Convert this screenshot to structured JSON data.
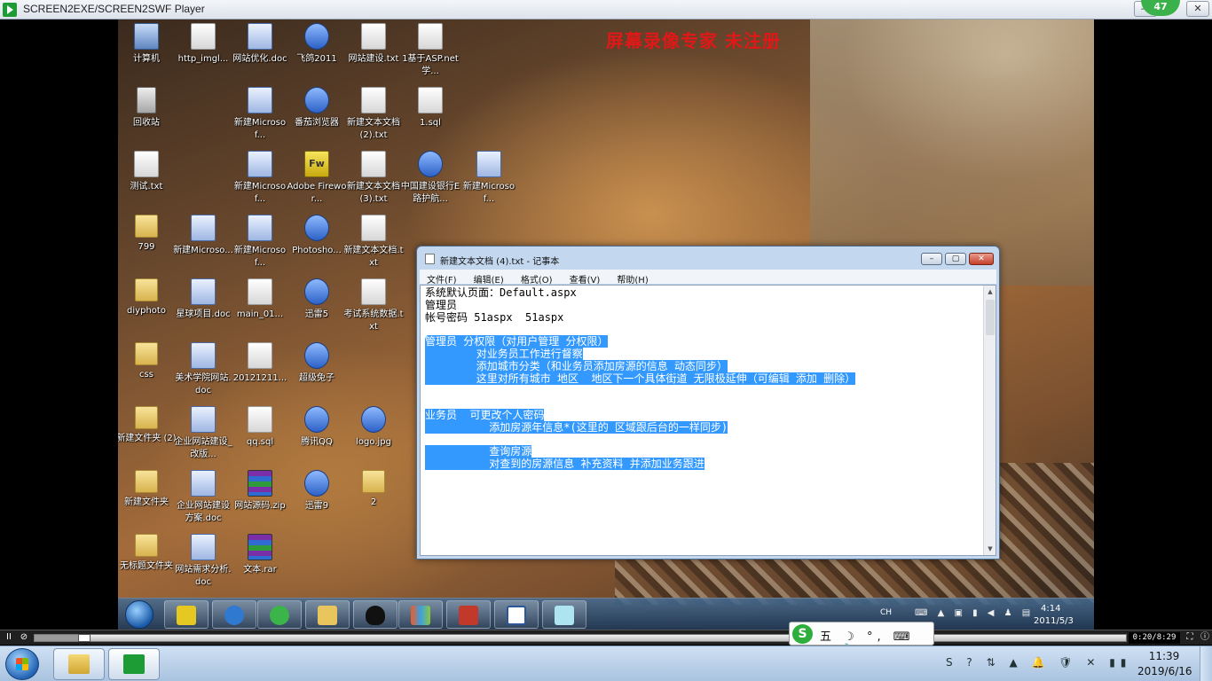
{
  "player": {
    "title": "SCREEN2EXE/SCREEN2SWF Player",
    "badge": "47",
    "controls": {
      "minimize": "—",
      "maximize": "▢",
      "close": "✕"
    }
  },
  "watermark": "屏幕录像专家 未注册",
  "desktop_icons": [
    {
      "label": "计算机",
      "kind": "pc"
    },
    {
      "label": "http_imgl...",
      "kind": "file"
    },
    {
      "label": "网站优化.doc",
      "kind": "doc"
    },
    {
      "label": "飞鸽2011",
      "kind": "app"
    },
    {
      "label": "网站建设.txt",
      "kind": "file"
    },
    {
      "label": "1基于ASP.net学...",
      "kind": "file"
    },
    {
      "label": "回收站",
      "kind": "trash"
    },
    {
      "label": "新建Microsof...",
      "kind": "doc"
    },
    {
      "label": "番茄浏览器",
      "kind": "app"
    },
    {
      "label": "新建文本文档 (2).txt",
      "kind": "file"
    },
    {
      "label": "1.sql",
      "kind": "file"
    },
    {
      "label": "测试.txt",
      "kind": "file"
    },
    {
      "label": "新建Microsof...",
      "kind": "doc"
    },
    {
      "label": "Adobe Firewor...",
      "kind": "fw"
    },
    {
      "label": "新建文本文档 (3).txt",
      "kind": "file"
    },
    {
      "label": "中国建设银行E路护航...",
      "kind": "app"
    },
    {
      "label": "新建Microsof...",
      "kind": "doc"
    },
    {
      "label": "799",
      "kind": "folder"
    },
    {
      "label": "新建Microso...",
      "kind": "doc"
    },
    {
      "label": "新建Microsof...",
      "kind": "doc"
    },
    {
      "label": "Photosho...",
      "kind": "app"
    },
    {
      "label": "新建文本文档.txt",
      "kind": "file"
    },
    {
      "label": "diyphoto",
      "kind": "folder"
    },
    {
      "label": "星球项目.doc",
      "kind": "doc"
    },
    {
      "label": "main_01...",
      "kind": "file"
    },
    {
      "label": "迅雷5",
      "kind": "app"
    },
    {
      "label": "考试系统数据.txt",
      "kind": "file"
    },
    {
      "label": "css",
      "kind": "folder"
    },
    {
      "label": "美术学院网站.doc",
      "kind": "doc"
    },
    {
      "label": "20121211...",
      "kind": "file"
    },
    {
      "label": "超级兔子",
      "kind": "app"
    },
    {
      "label": "新建文件夹 (2)",
      "kind": "folder"
    },
    {
      "label": "企业网站建设_改版...",
      "kind": "doc"
    },
    {
      "label": "qq.sql",
      "kind": "file"
    },
    {
      "label": "腾讯QQ",
      "kind": "app"
    },
    {
      "label": "logo.jpg",
      "kind": "app"
    },
    {
      "label": "新建文件夹",
      "kind": "folder"
    },
    {
      "label": "企业网站建设方案.doc",
      "kind": "doc"
    },
    {
      "label": "网站源码.zip",
      "kind": "rar"
    },
    {
      "label": "迅雷9",
      "kind": "app"
    },
    {
      "label": "2",
      "kind": "folder"
    },
    {
      "label": "无标题文件夹",
      "kind": "folder"
    },
    {
      "label": "网站需求分析.doc",
      "kind": "doc"
    },
    {
      "label": "文本.rar",
      "kind": "rar"
    }
  ],
  "notepad": {
    "title": "新建文本文档 (4).txt - 记事本",
    "menu": [
      "文件(F)",
      "编辑(E)",
      "格式(O)",
      "查看(V)",
      "帮助(H)"
    ],
    "lines": [
      {
        "text": "系统默认页面：Default.aspx",
        "selected": false
      },
      {
        "text": "管理员",
        "selected": false
      },
      {
        "text": "帐号密码 51aspx  51aspx",
        "selected": false
      },
      {
        "text": "",
        "selected": false
      },
      {
        "text": "管理员 分权限（对用户管理 分权限）",
        "selected": true
      },
      {
        "text": "        对业务员工作进行督察",
        "selected": true
      },
      {
        "text": "        添加城市分类（和业务员添加房源的信息 动态同步）",
        "selected": true
      },
      {
        "text": "        这里对所有城市 地区  地区下一个具体街道 无限极延伸（可编辑 添加 删除）",
        "selected": true
      },
      {
        "text": "",
        "selected": false
      },
      {
        "text": "",
        "selected": false
      },
      {
        "text": "业务员  可更改个人密码",
        "selected": true
      },
      {
        "text": "          添加房源年信息*(这里的 区域跟后台的一样同步)",
        "selected": true
      },
      {
        "text": "",
        "selected": false
      },
      {
        "text": "          查询房源",
        "selected": true
      },
      {
        "text": "          对查到的房源信息 补充资料 并添加业务跟进",
        "selected": true
      }
    ]
  },
  "recorded_taskbar": {
    "items": [
      "fireworks",
      "ie",
      "ie-green",
      "explorer",
      "qq",
      "media",
      "toolbox",
      "word",
      "notepad"
    ],
    "lang": "CH",
    "time": "4:14",
    "date": "2011/5/3"
  },
  "playback": {
    "time": "0:20/8:29",
    "progress": 0.04,
    "pause": "II",
    "stop": "⊘",
    "fit": "⛶",
    "info": "ⓘ"
  },
  "ime": {
    "logo": "S",
    "mode": "五",
    "items": "☽ °, ⌨ ● 🔧"
  },
  "host_taskbar": {
    "time": "11:39",
    "date": "2019/6/16",
    "tray_icons": "S ? ⇅ ▲ 🔔 🛡 ✕ ▮▮"
  },
  "colors": {
    "selection": "#3399ff",
    "watermark": "#e21717",
    "badge": "#3ab14a"
  }
}
